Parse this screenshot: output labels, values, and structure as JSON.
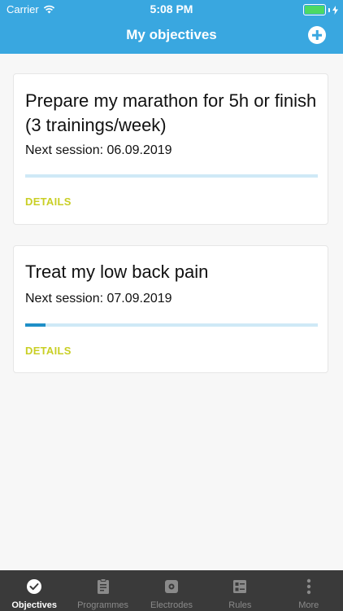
{
  "status_bar": {
    "carrier": "Carrier",
    "time": "5:08 PM",
    "battery_level": 1.0
  },
  "header": {
    "title": "My objectives",
    "add_icon": "plus-circle-icon",
    "background": "#39a7e0"
  },
  "objectives": [
    {
      "title": "Prepare my marathon for 5h or finish (3 trainings/week)",
      "next_session": "Next session: 06.09.2019",
      "progress": 0.0,
      "details_label": "DETAILS"
    },
    {
      "title": "Treat my low back pain",
      "next_session": "Next session: 07.09.2019",
      "progress": 0.07,
      "details_label": "DETAILS"
    }
  ],
  "tabbar": {
    "items": [
      {
        "label": "Objectives",
        "icon": "check-circle-icon",
        "active": true
      },
      {
        "label": "Programmes",
        "icon": "clipboard-icon",
        "active": false
      },
      {
        "label": "Electrodes",
        "icon": "electrode-icon",
        "active": false
      },
      {
        "label": "Rules",
        "icon": "rules-icon",
        "active": false
      },
      {
        "label": "More",
        "icon": "more-vertical-icon",
        "active": false
      }
    ]
  },
  "colors": {
    "accent": "#39a7e0",
    "progress_fill": "#1f8fc7",
    "progress_track": "#cfe9f6",
    "details": "#c9cf25",
    "tabbar": "#3a3a3a"
  }
}
